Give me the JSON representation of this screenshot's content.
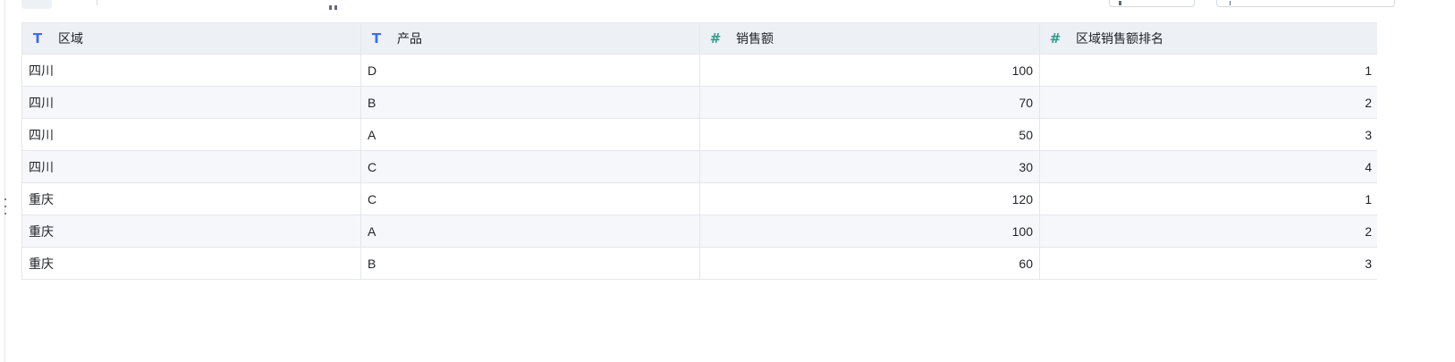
{
  "toolbar": {
    "grid_view_icon": "grid-view-icon",
    "list_view_icon": "list-view-icon"
  },
  "table": {
    "columns": [
      {
        "label": "区域",
        "type": "text",
        "icon": "text-type-icon"
      },
      {
        "label": "产品",
        "type": "text",
        "icon": "text-type-icon"
      },
      {
        "label": "销售额",
        "type": "number",
        "icon": "number-type-icon"
      },
      {
        "label": "区域销售额排名",
        "type": "number",
        "icon": "number-type-icon"
      }
    ],
    "type_glyphs": {
      "text": "T",
      "number": "#"
    },
    "rows": [
      [
        "四川",
        "D",
        "100",
        "1"
      ],
      [
        "四川",
        "B",
        "70",
        "2"
      ],
      [
        "四川",
        "A",
        "50",
        "3"
      ],
      [
        "四川",
        "C",
        "30",
        "4"
      ],
      [
        "重庆",
        "C",
        "120",
        "1"
      ],
      [
        "重庆",
        "A",
        "100",
        "2"
      ],
      [
        "重庆",
        "B",
        "60",
        "3"
      ]
    ]
  },
  "colors": {
    "header_bg": "#edf0f5",
    "stripe_bg": "#f5f7fa",
    "border": "#e4e7ec",
    "text_type_accent": "#3d6ee8",
    "number_type_accent": "#2f9e8f"
  }
}
